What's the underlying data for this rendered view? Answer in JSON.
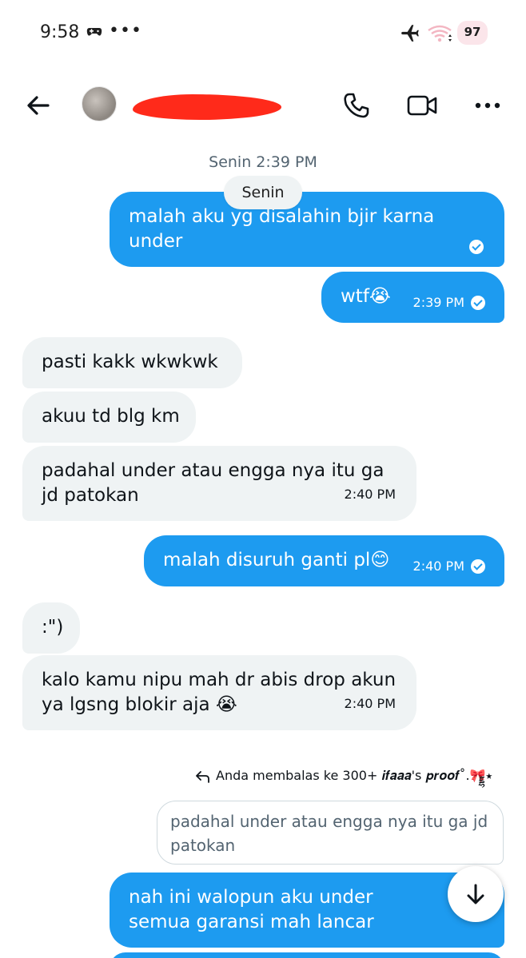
{
  "status_bar": {
    "time": "9:58",
    "more_dots": "•••",
    "battery_level": "97",
    "icons": [
      "gamepad-icon",
      "airplane-icon",
      "wifi-icon",
      "battery-icon"
    ]
  },
  "header": {
    "contact_name": "",
    "icons": [
      "back-arrow-icon",
      "phone-icon",
      "video-icon",
      "more-icon"
    ]
  },
  "chat": {
    "day_time": "Senin 2:39 PM",
    "day_chip": "Senin",
    "messages": [
      {
        "dir": "out",
        "text": "malah aku yg disalahin bjir karna under",
        "time": ""
      },
      {
        "dir": "out",
        "text": "wtf😭",
        "time": "2:39 PM"
      },
      {
        "dir": "in",
        "text": "pasti kakk wkwkwk",
        "time": ""
      },
      {
        "dir": "in",
        "text": "akuu td blg km",
        "time": ""
      },
      {
        "dir": "in",
        "text": "padahal under atau engga nya itu ga jd patokan",
        "time": "2:40 PM"
      },
      {
        "dir": "out",
        "text": "malah disuruh ganti pl😊",
        "time": "2:40 PM"
      },
      {
        "dir": "in",
        "text": ":\")",
        "time": ""
      },
      {
        "dir": "in",
        "text": "kalo kamu nipu mah dr abis drop akun ya lgsng blokir aja 😭",
        "time": "2:40 PM"
      },
      {
        "dir": "out",
        "text": "nah ini walopun aku under semua garansi mah lancar",
        "time": ""
      }
    ],
    "reply_label": "Anda membalas ke 300+ 𝒊𝒇𝒂𝒂𝒂's 𝒑𝒓𝒐𝒐𝒇˚.🎀྘⭑",
    "quoted_text": "padahal under atau engga nya itu ga jd patokan"
  },
  "colors": {
    "outgoing_bubble": "#1d9bf0",
    "incoming_bubble": "#eff3f4",
    "muted_text": "#536471"
  }
}
